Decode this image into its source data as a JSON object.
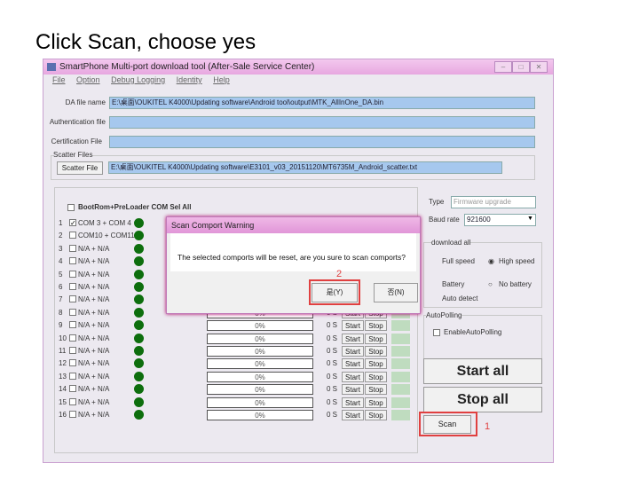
{
  "heading": "Click Scan,  choose yes",
  "window": {
    "title": "SmartPhone Multi-port download tool (After-Sale Service Center)",
    "menu": [
      "File",
      "Option",
      "Debug Logging",
      "Identity",
      "Help"
    ]
  },
  "files": {
    "da_label": "DA file name",
    "da_value": "E:\\桌面\\OUKITEL K4000\\Updating software\\Android tool\\output\\MTK_AllInOne_DA.bin",
    "auth_label": "Authentication file",
    "auth_value": "",
    "cert_label": "Certification File",
    "cert_value": "",
    "scatter_group": "Scatter Files",
    "scatter_button": "Scatter File",
    "scatter_value": "E:\\桌面\\OUKITEL K4000\\Updating software\\E3101_v03_20151120\\MT6735M_Android_scatter.txt"
  },
  "ports": {
    "sel_all": "BootRom+PreLoader COM Sel All",
    "rows": [
      {
        "n": "1",
        "checked": true,
        "label": "COM 3 + COM 4"
      },
      {
        "n": "2",
        "checked": false,
        "label": "COM10 + COM11"
      },
      {
        "n": "3",
        "checked": false,
        "label": "N/A + N/A"
      },
      {
        "n": "4",
        "checked": false,
        "label": "N/A + N/A"
      },
      {
        "n": "5",
        "checked": false,
        "label": "N/A + N/A"
      },
      {
        "n": "6",
        "checked": false,
        "label": "N/A + N/A"
      },
      {
        "n": "7",
        "checked": false,
        "label": "N/A + N/A"
      },
      {
        "n": "8",
        "checked": false,
        "label": "N/A + N/A"
      },
      {
        "n": "9",
        "checked": false,
        "label": "N/A + N/A"
      },
      {
        "n": "10",
        "checked": false,
        "label": "N/A + N/A"
      },
      {
        "n": "11",
        "checked": false,
        "label": "N/A + N/A"
      },
      {
        "n": "12",
        "checked": false,
        "label": "N/A + N/A"
      },
      {
        "n": "13",
        "checked": false,
        "label": "N/A + N/A"
      },
      {
        "n": "14",
        "checked": false,
        "label": "N/A + N/A"
      },
      {
        "n": "15",
        "checked": false,
        "label": "N/A + N/A"
      },
      {
        "n": "16",
        "checked": false,
        "label": "N/A + N/A"
      }
    ],
    "progress": "0%",
    "time": "0 S",
    "start": "Start",
    "stop": "Stop",
    "status_color": "#0d6e0d"
  },
  "right": {
    "type_label": "Type",
    "type_value": "Firmware upgrade",
    "baud_label": "Baud rate",
    "baud_value": "921600",
    "download_group": "download all",
    "full_speed": "Full speed",
    "high_speed": "High speed",
    "speed_selected": "High speed",
    "battery": "Battery",
    "no_battery": "No battery",
    "auto_detect": "Auto detect",
    "battery_selected": "Battery",
    "autopolling_group": "AutoPolling",
    "enable_autopolling": "EnableAutoPolling",
    "start_all": "Start all",
    "stop_all": "Stop all",
    "scan": "Scan",
    "annotation1": "1"
  },
  "dialog": {
    "title": "Scan Comport Warning",
    "message": "The selected comports will be reset, are you sure to scan comports?",
    "yes": "是(Y)",
    "no": "否(N)",
    "annotation2": "2"
  },
  "colors": {
    "annotation": "#e04040",
    "field": "#a6c8ee"
  }
}
